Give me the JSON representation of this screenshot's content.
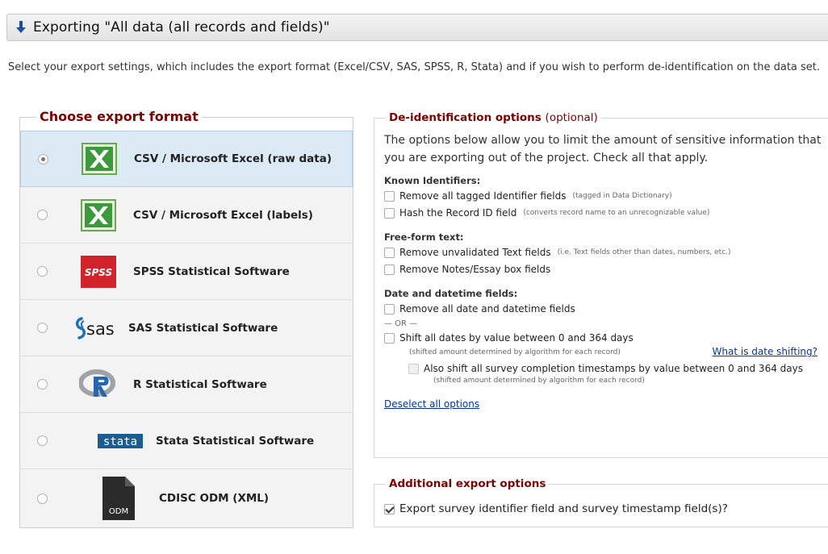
{
  "header": {
    "title": "Exporting \"All data (all records and fields)\""
  },
  "intro": {
    "text": "Select your export settings, which includes the export format (Excel/CSV, SAS, SPSS, R, Stata) and if you wish to perform de-identification on the data set."
  },
  "formats": {
    "legend": "Choose export format",
    "items": [
      {
        "label": "CSV / Microsoft Excel (raw data)",
        "icon": "excel-icon",
        "selected": true
      },
      {
        "label": "CSV / Microsoft Excel (labels)",
        "icon": "excel-icon",
        "selected": false
      },
      {
        "label": "SPSS Statistical Software",
        "icon": "spss-logo",
        "selected": false
      },
      {
        "label": "SAS Statistical Software",
        "icon": "sas-logo",
        "selected": false
      },
      {
        "label": "R Statistical Software",
        "icon": "r-logo",
        "selected": false
      },
      {
        "label": "Stata Statistical Software",
        "icon": "stata-logo",
        "selected": false
      },
      {
        "label": "CDISC ODM (XML)",
        "icon": "odm-file-icon",
        "selected": false
      }
    ],
    "logo_text": {
      "spss": "SPSS",
      "sas": "sas",
      "stata": "stata",
      "odm": "ODM"
    }
  },
  "deid": {
    "legend": "De-identification options",
    "legend_optional": "(optional)",
    "intro": "The options below allow you to limit the amount of sensitive information that you are exporting out of the project. Check all that apply.",
    "known_title": "Known Identifiers:",
    "remove_tagged": "Remove all tagged Identifier fields",
    "remove_tagged_note": "(tagged in Data Dictionary)",
    "hash_record": "Hash the Record ID field",
    "hash_record_note": "(converts record name to an unrecognizable value)",
    "freeform_title": "Free-form text:",
    "remove_text": "Remove unvalidated Text fields",
    "remove_text_note": "(i.e. Text fields other than dates, numbers, etc.)",
    "remove_notes": "Remove Notes/Essay box fields",
    "date_title": "Date and datetime fields:",
    "remove_dates": "Remove all date and datetime fields",
    "or_text": "— OR —",
    "shift_dates": "Shift all dates by value between 0 and 364 days",
    "shift_note": "(shifted amount determined by algorithm for each record)",
    "what_is_link": "What is date shifting?",
    "shift_survey": "Also shift all survey completion timestamps by value between 0 and 364 days",
    "shift_survey_note": "(shifted amount determined by algorithm for each record)",
    "deselect_link": "Deselect all options"
  },
  "additional": {
    "legend": "Additional export options",
    "survey_fields": "Export survey identifier field and survey timestamp field(s)?",
    "survey_fields_checked": true
  },
  "colors": {
    "legend_red": "#800000",
    "link_blue": "#00369e",
    "selected_row": "#dbeaf4",
    "excel_green": "#2e8b2e",
    "spss_red": "#d2232a",
    "sas_blue": "#1a6fb5",
    "stata_blue": "#1b5c91"
  }
}
